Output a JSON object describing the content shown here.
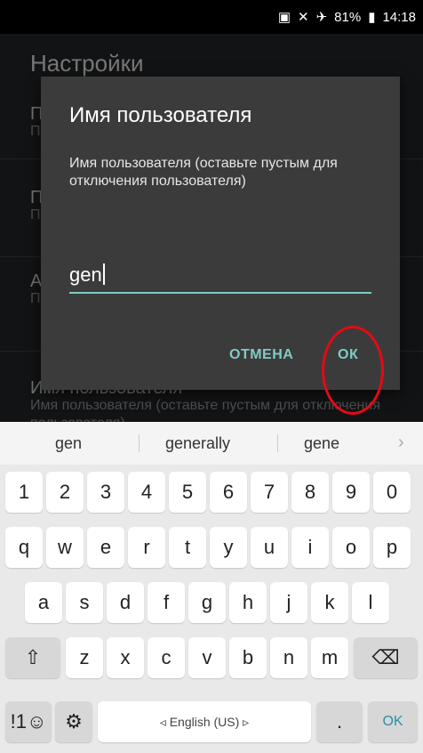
{
  "status": {
    "battery": "81%",
    "time": "14:18"
  },
  "app": {
    "title": "Настройки",
    "prefs": [
      {
        "title": "П",
        "summary": "П"
      },
      {
        "title": "П",
        "summary": "П"
      },
      {
        "title": "А",
        "summary": "П"
      },
      {
        "title": "Имя пользователя",
        "summary": "Имя пользователя (оставьте пустым для отключения пользователя)"
      }
    ]
  },
  "dialog": {
    "title": "Имя пользователя",
    "message": "Имя пользователя (оставьте пустым для отключения пользователя)",
    "value": "gen",
    "cancel": "ОТМЕНА",
    "ok": "ОК"
  },
  "keyboard": {
    "suggestions": [
      "gen",
      "generally",
      "gene"
    ],
    "row_numbers": [
      "1",
      "2",
      "3",
      "4",
      "5",
      "6",
      "7",
      "8",
      "9",
      "0"
    ],
    "row_q": [
      "q",
      "w",
      "e",
      "r",
      "t",
      "y",
      "u",
      "i",
      "o",
      "p"
    ],
    "row_a": [
      "a",
      "s",
      "d",
      "f",
      "g",
      "h",
      "j",
      "k",
      "l"
    ],
    "row_z": [
      "z",
      "x",
      "c",
      "v",
      "b",
      "n",
      "m"
    ],
    "symbols_label": "!1☺",
    "space_label": "◃ English (US) ▹",
    "period": ".",
    "ok": "OK"
  },
  "colors": {
    "accent": "#80cbc4",
    "highlight": "#e50914"
  }
}
